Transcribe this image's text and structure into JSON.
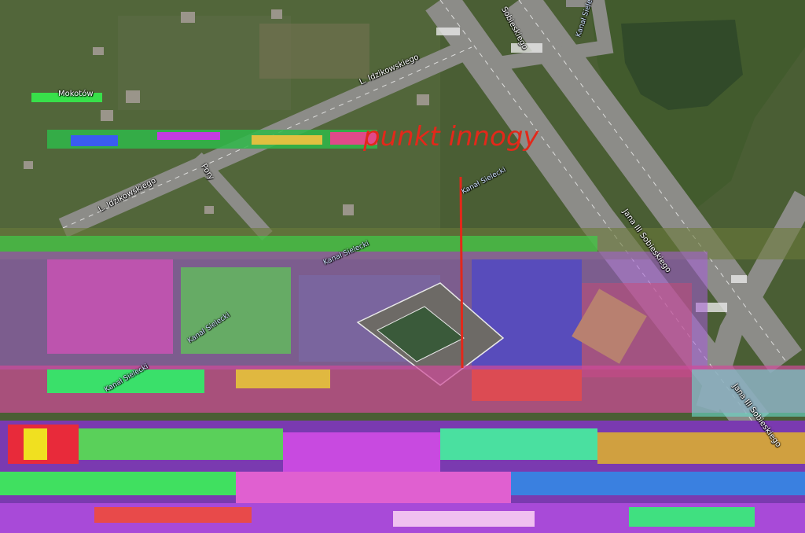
{
  "map": {
    "marker_label": "punkt innogy",
    "marker_color": "#e3281a",
    "labels": {
      "district_mokotow": "Mokotów",
      "street_idzikowskiego_top": "L. Idzikowskiego",
      "street_idzikowskiego_left": "L. Idzikowskiego",
      "street_pory": "Pory",
      "canal_top": "Kanał Sielecki",
      "canal_marker": "Kanał Sielecki",
      "canal_mid": "Kanał Sielecki",
      "canal_lower": "Kanał Sielecki",
      "street_sobieskiego_top": "Sobieskiego",
      "street_sobieskiego_mid": "Jana III Sobieskiego",
      "street_sobieskiego_low": "Jana III Sobieskiego",
      "canal_upper_left": "Kanał Sielecki"
    },
    "colors": {
      "vegetation": "#4a5e34",
      "road": "#8c8c88",
      "water": "#1f3328",
      "glitch_magenta": "#c43be0",
      "glitch_green": "#38e04a",
      "glitch_blue": "#3a5cf0"
    }
  }
}
